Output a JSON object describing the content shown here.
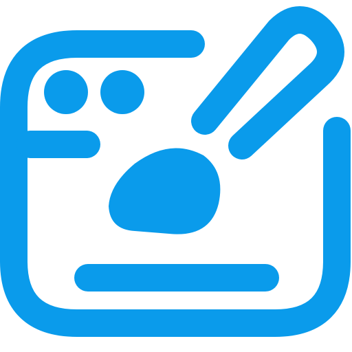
{
  "icon": {
    "name": "paint-window-icon",
    "color": "#0A9BEB",
    "background": "#FFFFFF"
  }
}
